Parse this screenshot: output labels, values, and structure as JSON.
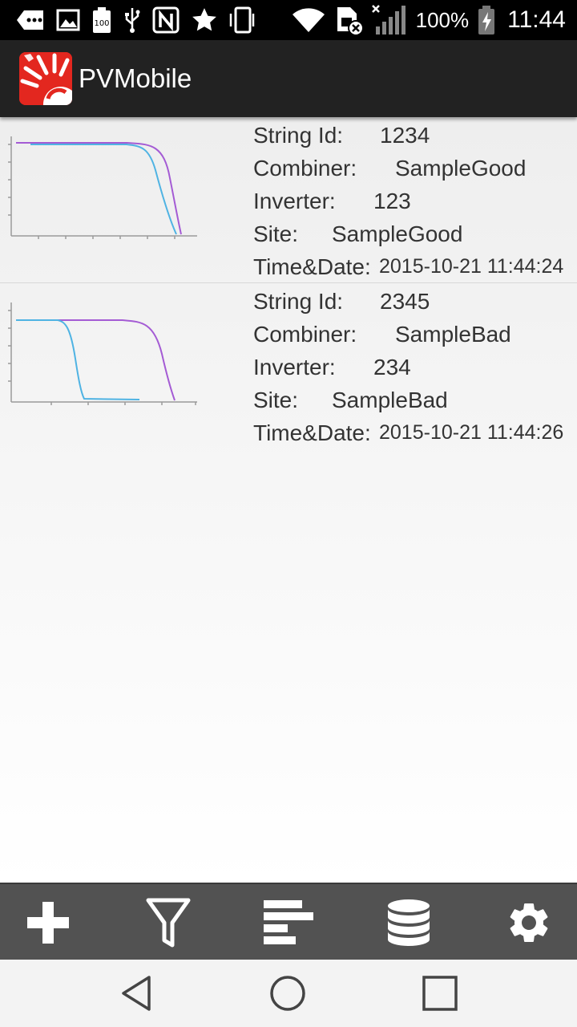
{
  "status_bar": {
    "battery_percent": "100%",
    "clock": "11:44",
    "battery_saver_label": "100"
  },
  "app": {
    "title": "PVMobile",
    "accent_color": "#e3271f"
  },
  "labels": {
    "string_id": "String Id:",
    "combiner": "Combiner:",
    "inverter": "Inverter:",
    "site": "Site:",
    "time_date": "Time&Date:"
  },
  "records": [
    {
      "string_id": "1234",
      "combiner": "SampleGood",
      "inverter": "123",
      "site": "SampleGood",
      "time_date": "2015-10-21 11:44:24"
    },
    {
      "string_id": "2345",
      "combiner": "SampleBad",
      "inverter": "234",
      "site": "SampleBad",
      "time_date": "2015-10-21 11:44:26"
    }
  ],
  "toolbar": {
    "icons": [
      "add-icon",
      "filter-icon",
      "bar-chart-icon",
      "database-icon",
      "gear-icon"
    ]
  },
  "navbar": {
    "icons": [
      "back-icon",
      "home-icon",
      "recents-icon"
    ]
  },
  "colors": {
    "curve_reference": "#a45bd4",
    "curve_measured": "#4fb3e3"
  }
}
